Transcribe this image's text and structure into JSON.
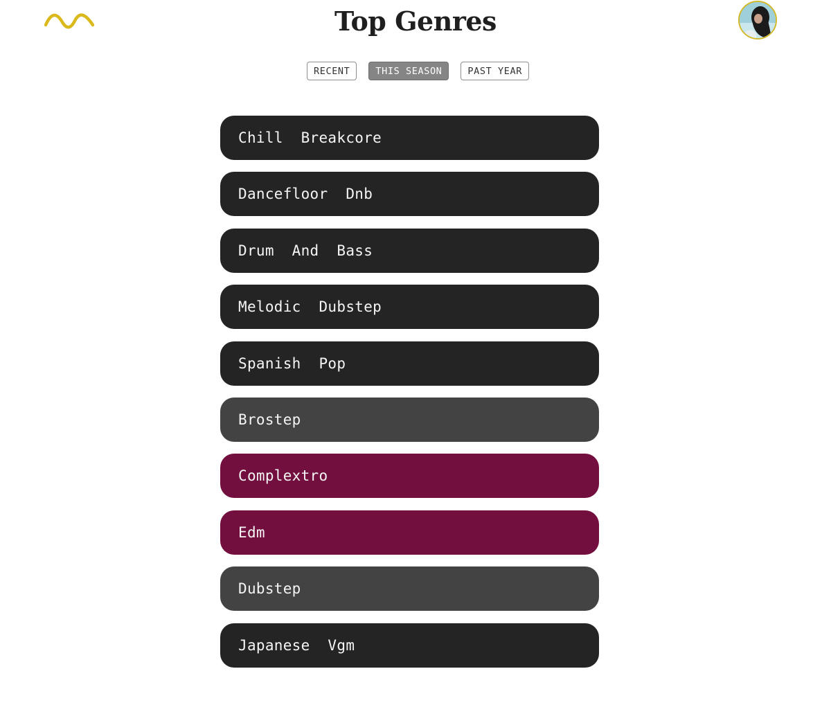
{
  "header": {
    "logo_icon": "wave-logo-icon",
    "logo_color": "#d9b91c",
    "title": "Top Genres",
    "avatar_icon": "user-avatar"
  },
  "time_range": {
    "selected": "THIS SEASON",
    "tabs": [
      {
        "label": "RECENT",
        "active": false
      },
      {
        "label": "THIS SEASON",
        "active": true
      },
      {
        "label": "PAST YEAR",
        "active": false
      }
    ]
  },
  "colors": {
    "dark": "#242424",
    "gray": "#434343",
    "crimson": "#730f3e",
    "accent": "#d9b91c"
  },
  "genres": [
    {
      "name": "Chill  Breakcore",
      "color": "#242424"
    },
    {
      "name": "Dancefloor  Dnb",
      "color": "#242424"
    },
    {
      "name": "Drum  And  Bass",
      "color": "#242424"
    },
    {
      "name": "Melodic  Dubstep",
      "color": "#242424"
    },
    {
      "name": "Spanish  Pop",
      "color": "#242424"
    },
    {
      "name": "Brostep",
      "color": "#434343"
    },
    {
      "name": "Complextro",
      "color": "#730f3e"
    },
    {
      "name": "Edm",
      "color": "#730f3e"
    },
    {
      "name": "Dubstep",
      "color": "#434343"
    },
    {
      "name": "Japanese  Vgm",
      "color": "#242424"
    }
  ]
}
